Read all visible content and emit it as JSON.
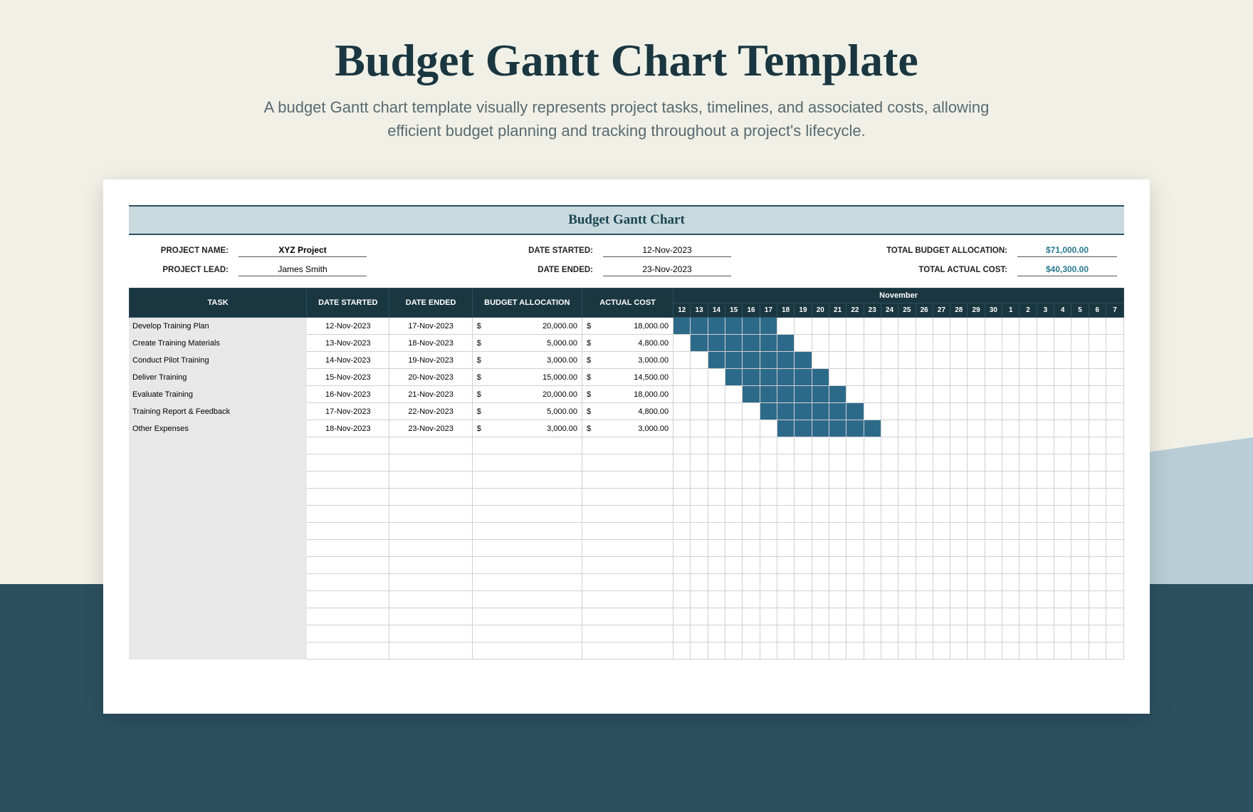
{
  "header": {
    "title": "Budget Gantt Chart Template",
    "subtitle": "A budget Gantt chart template visually represents project tasks, timelines, and associated costs, allowing efficient budget planning and tracking throughout a project's lifecycle."
  },
  "banner": "Budget Gantt Chart",
  "meta": {
    "project_name_label": "PROJECT NAME:",
    "project_name": "XYZ Project",
    "project_lead_label": "PROJECT LEAD:",
    "project_lead": "James Smith",
    "date_started_label": "DATE STARTED:",
    "date_started": "12-Nov-2023",
    "date_ended_label": "DATE ENDED:",
    "date_ended": "23-Nov-2023",
    "total_budget_label": "TOTAL BUDGET ALLOCATION:",
    "total_budget": "$71,000.00",
    "total_actual_label": "TOTAL ACTUAL COST:",
    "total_actual": "$40,300.00"
  },
  "columns": {
    "task": "TASK",
    "date_started": "DATE STARTED",
    "date_ended": "DATE ENDED",
    "budget": "BUDGET ALLOCATION",
    "actual": "ACTUAL COST",
    "month": "November"
  },
  "days": [
    "12",
    "13",
    "14",
    "15",
    "16",
    "17",
    "18",
    "19",
    "20",
    "21",
    "22",
    "23",
    "24",
    "25",
    "26",
    "27",
    "28",
    "29",
    "30",
    "1",
    "2",
    "3",
    "4",
    "5",
    "6",
    "7"
  ],
  "rows": [
    {
      "task": "Develop Training Plan",
      "start": "12-Nov-2023",
      "end": "17-Nov-2023",
      "budget": "20,000.00",
      "actual": "18,000.00",
      "bar_start": 0,
      "bar_end": 5
    },
    {
      "task": "Create Training Materials",
      "start": "13-Nov-2023",
      "end": "18-Nov-2023",
      "budget": "5,000.00",
      "actual": "4,800.00",
      "bar_start": 1,
      "bar_end": 6
    },
    {
      "task": "Conduct Pilot Training",
      "start": "14-Nov-2023",
      "end": "19-Nov-2023",
      "budget": "3,000.00",
      "actual": "3,000.00",
      "bar_start": 2,
      "bar_end": 7
    },
    {
      "task": "Deliver Training",
      "start": "15-Nov-2023",
      "end": "20-Nov-2023",
      "budget": "15,000.00",
      "actual": "14,500.00",
      "bar_start": 3,
      "bar_end": 8
    },
    {
      "task": "Evaluate Training",
      "start": "16-Nov-2023",
      "end": "21-Nov-2023",
      "budget": "20,000.00",
      "actual": "18,000.00",
      "bar_start": 4,
      "bar_end": 9
    },
    {
      "task": "Training Report & Feedback",
      "start": "17-Nov-2023",
      "end": "22-Nov-2023",
      "budget": "5,000.00",
      "actual": "4,800.00",
      "bar_start": 5,
      "bar_end": 10
    },
    {
      "task": "Other Expenses",
      "start": "18-Nov-2023",
      "end": "23-Nov-2023",
      "budget": "3,000.00",
      "actual": "3,000.00",
      "bar_start": 6,
      "bar_end": 11
    }
  ],
  "empty_rows": 13,
  "currency": "$",
  "chart_data": {
    "type": "gantt",
    "title": "Budget Gantt Chart",
    "x_axis": {
      "label": "November",
      "start": "12-Nov-2023",
      "end": "7-Dec-2023",
      "ticks": [
        "12",
        "13",
        "14",
        "15",
        "16",
        "17",
        "18",
        "19",
        "20",
        "21",
        "22",
        "23",
        "24",
        "25",
        "26",
        "27",
        "28",
        "29",
        "30",
        "1",
        "2",
        "3",
        "4",
        "5",
        "6",
        "7"
      ]
    },
    "series": [
      {
        "name": "Develop Training Plan",
        "start": "12-Nov-2023",
        "end": "17-Nov-2023",
        "budget": 20000,
        "actual": 18000
      },
      {
        "name": "Create Training Materials",
        "start": "13-Nov-2023",
        "end": "18-Nov-2023",
        "budget": 5000,
        "actual": 4800
      },
      {
        "name": "Conduct Pilot Training",
        "start": "14-Nov-2023",
        "end": "19-Nov-2023",
        "budget": 3000,
        "actual": 3000
      },
      {
        "name": "Deliver Training",
        "start": "15-Nov-2023",
        "end": "20-Nov-2023",
        "budget": 15000,
        "actual": 14500
      },
      {
        "name": "Evaluate Training",
        "start": "16-Nov-2023",
        "end": "21-Nov-2023",
        "budget": 20000,
        "actual": 18000
      },
      {
        "name": "Training Report & Feedback",
        "start": "17-Nov-2023",
        "end": "22-Nov-2023",
        "budget": 5000,
        "actual": 4800
      },
      {
        "name": "Other Expenses",
        "start": "18-Nov-2023",
        "end": "23-Nov-2023",
        "budget": 3000,
        "actual": 3000
      }
    ],
    "totals": {
      "budget": 71000,
      "actual": 40300
    }
  }
}
